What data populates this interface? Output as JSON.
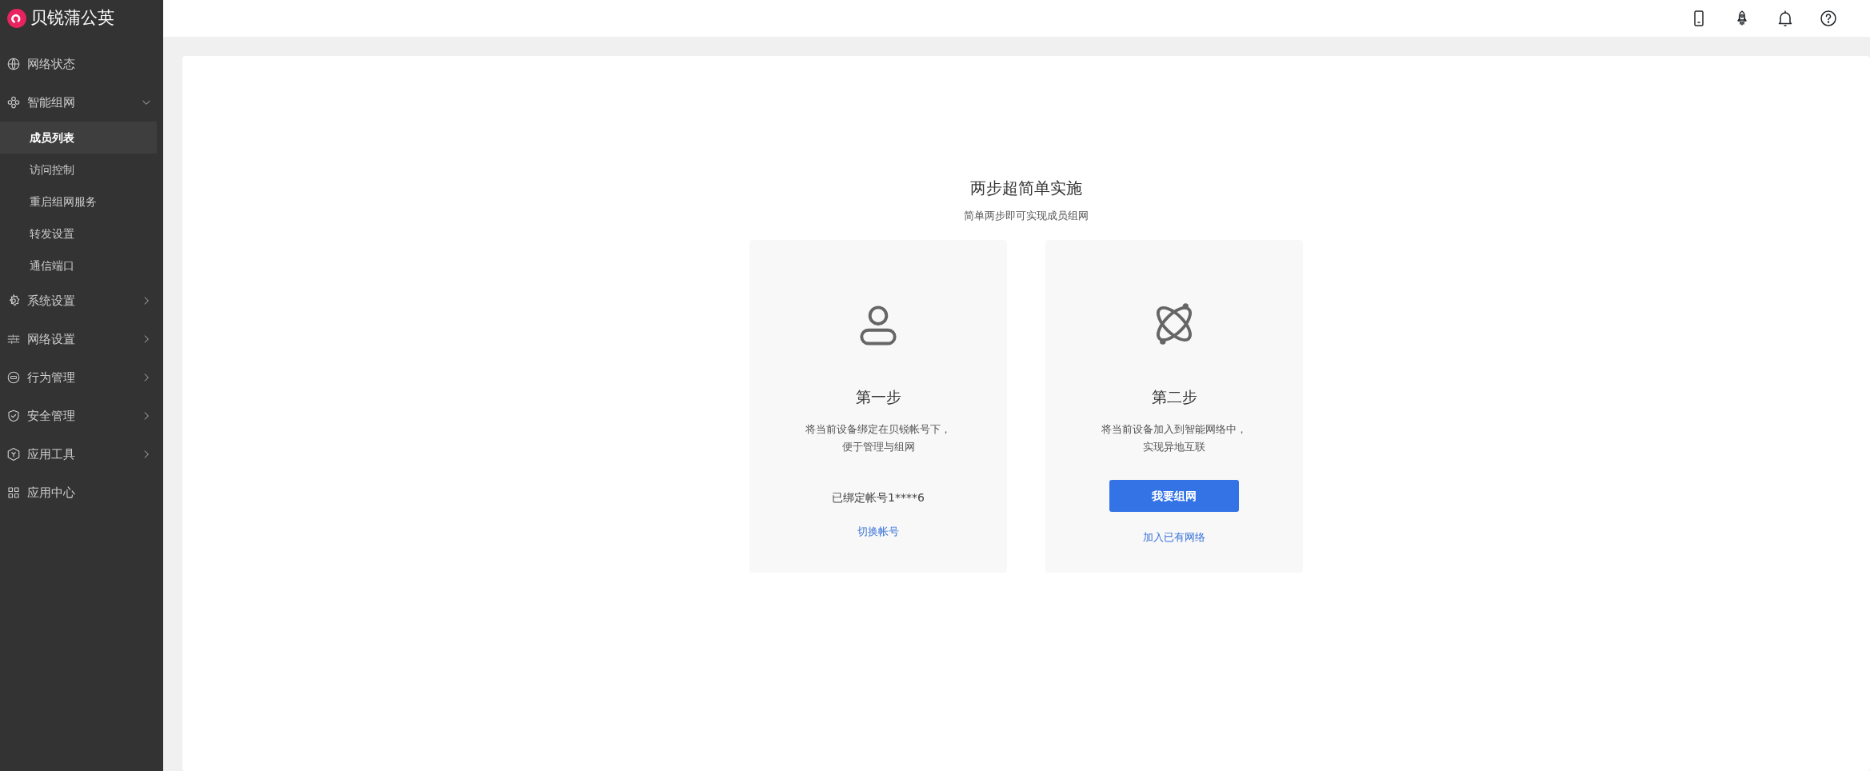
{
  "brand": {
    "name": "贝锐蒲公英"
  },
  "sidebar": {
    "items": [
      {
        "label": "网络状态"
      },
      {
        "label": "智能组网",
        "expanded": true,
        "children": [
          {
            "label": "成员列表",
            "selected": true
          },
          {
            "label": "访问控制",
            "selected": false
          },
          {
            "label": "重启组网服务",
            "selected": false
          },
          {
            "label": "转发设置",
            "selected": false
          },
          {
            "label": "通信端口",
            "selected": false
          }
        ]
      },
      {
        "label": "系统设置",
        "expanded": false
      },
      {
        "label": "网络设置",
        "expanded": false
      },
      {
        "label": "行为管理",
        "expanded": false
      },
      {
        "label": "安全管理",
        "expanded": false
      },
      {
        "label": "应用工具",
        "expanded": false
      },
      {
        "label": "应用中心"
      }
    ]
  },
  "main": {
    "title": "两步超简单实施",
    "subtitle": "简单两步即可实现成员组网",
    "steps": [
      {
        "kind": "account",
        "title": "第一步",
        "description": [
          "将当前设备绑定在贝锐帐号下，",
          "便于管理与组网"
        ],
        "account": "已绑定帐号1****6",
        "link": "切换帐号"
      },
      {
        "kind": "join",
        "title": "第二步",
        "description": [
          "将当前设备加入到智能网络中，",
          "实现异地互联"
        ],
        "button": "我要组网",
        "link": "加入已有网络"
      }
    ]
  }
}
